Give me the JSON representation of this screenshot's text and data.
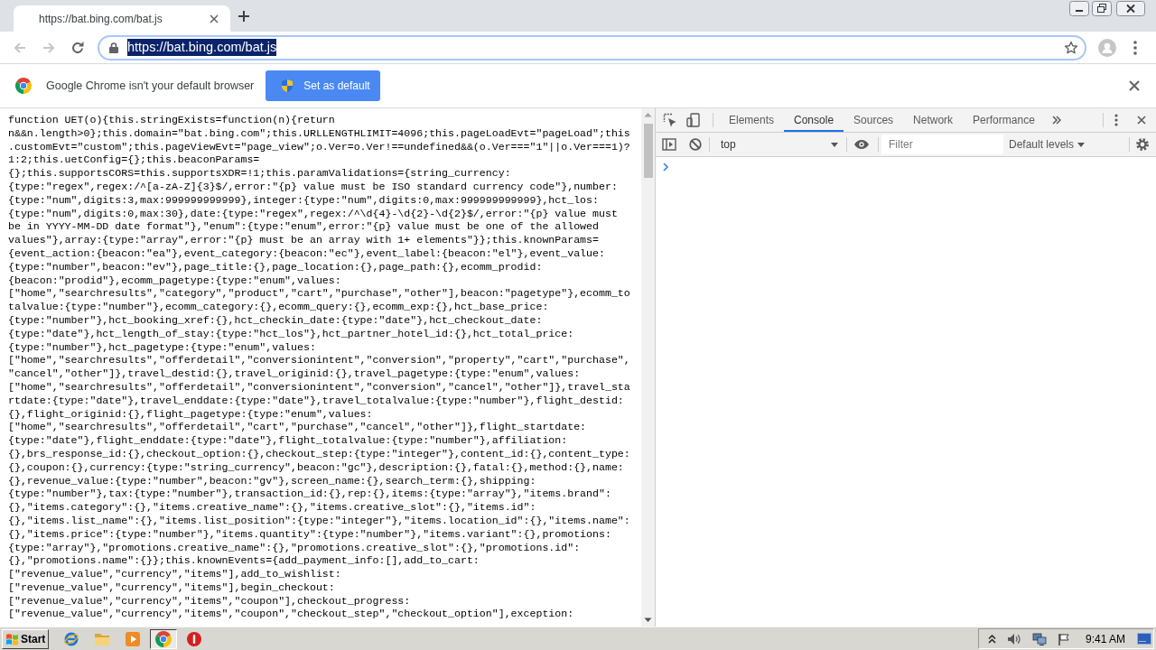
{
  "tabs": [
    {
      "title": "https://bat.bing.com/bat.js",
      "selected": true
    }
  ],
  "toolbar": {
    "nav": [
      {
        "kind": "back",
        "disabled": true
      },
      {
        "kind": "forward",
        "disabled": true
      },
      {
        "kind": "reload",
        "disabled": false
      }
    ],
    "address_bar": {
      "url": "https://bat.bing.com/bat.js",
      "selected": true
    }
  },
  "infobar": {
    "message": "Google Chrome isn't your default browser",
    "button": "Set as default"
  },
  "source": {
    "lines": [
      "function UET(o){this.stringExists=function(n){return",
      "n&&n.length>0};this.domain=\"bat.bing.com\";this.URLLENGTHLIMIT=4096;this.pageLoadEvt=\"pageLoad\";this",
      ".customEvt=\"custom\";this.pageViewEvt=\"page_view\";o.Ver=o.Ver!==undefined&&(o.Ver===\"1\"||o.Ver===1)?",
      "1:2;this.uetConfig={};this.beaconParams=",
      "{};this.supportsCORS=this.supportsXDR=!1;this.paramValidations={string_currency:",
      "{type:\"regex\",regex:/^[a-zA-Z]{3}$/,error:\"{p} value must be ISO standard currency code\"},number:",
      "{type:\"num\",digits:3,max:999999999999},integer:{type:\"num\",digits:0,max:999999999999},hct_los:",
      "{type:\"num\",digits:0,max:30},date:{type:\"regex\",regex:/^\\d{4}-\\d{2}-\\d{2}$/,error:\"{p} value must",
      "be in YYYY-MM-DD date format\"},\"enum\":{type:\"enum\",error:\"{p} value must be one of the allowed",
      "values\"},array:{type:\"array\",error:\"{p} must be an array with 1+ elements\"}};this.knownParams=",
      "{event_action:{beacon:\"ea\"},event_category:{beacon:\"ec\"},event_label:{beacon:\"el\"},event_value:",
      "{type:\"number\",beacon:\"ev\"},page_title:{},page_location:{},page_path:{},ecomm_prodid:",
      "{beacon:\"prodid\"},ecomm_pagetype:{type:\"enum\",values:",
      "[\"home\",\"searchresults\",\"category\",\"product\",\"cart\",\"purchase\",\"other\"],beacon:\"pagetype\"},ecomm_to",
      "talvalue:{type:\"number\"},ecomm_category:{},ecomm_query:{},ecomm_exp:{},hct_base_price:",
      "{type:\"number\"},hct_booking_xref:{},hct_checkin_date:{type:\"date\"},hct_checkout_date:",
      "{type:\"date\"},hct_length_of_stay:{type:\"hct_los\"},hct_partner_hotel_id:{},hct_total_price:",
      "{type:\"number\"},hct_pagetype:{type:\"enum\",values:",
      "[\"home\",\"searchresults\",\"offerdetail\",\"conversionintent\",\"conversion\",\"property\",\"cart\",\"purchase\",",
      "\"cancel\",\"other\"]},travel_destid:{},travel_originid:{},travel_pagetype:{type:\"enum\",values:",
      "[\"home\",\"searchresults\",\"offerdetail\",\"conversionintent\",\"conversion\",\"cancel\",\"other\"]},travel_sta",
      "rtdate:{type:\"date\"},travel_enddate:{type:\"date\"},travel_totalvalue:{type:\"number\"},flight_destid:",
      "{},flight_originid:{},flight_pagetype:{type:\"enum\",values:",
      "[\"home\",\"searchresults\",\"offerdetail\",\"cart\",\"purchase\",\"cancel\",\"other\"]},flight_startdate:",
      "{type:\"date\"},flight_enddate:{type:\"date\"},flight_totalvalue:{type:\"number\"},affiliation:",
      "{},brs_response_id:{},checkout_option:{},checkout_step:{type:\"integer\"},content_id:{},content_type:",
      "{},coupon:{},currency:{type:\"string_currency\",beacon:\"gc\"},description:{},fatal:{},method:{},name:",
      "{},revenue_value:{type:\"number\",beacon:\"gv\"},screen_name:{},search_term:{},shipping:",
      "{type:\"number\"},tax:{type:\"number\"},transaction_id:{},rep:{},items:{type:\"array\"},\"items.brand\":",
      "{},\"items.category\":{},\"items.creative_name\":{},\"items.creative_slot\":{},\"items.id\":",
      "{},\"items.list_name\":{},\"items.list_position\":{type:\"integer\"},\"items.location_id\":{},\"items.name\":",
      "{},\"items.price\":{type:\"number\"},\"items.quantity\":{type:\"number\"},\"items.variant\":{},promotions:",
      "{type:\"array\"},\"promotions.creative_name\":{},\"promotions.creative_slot\":{},\"promotions.id\":",
      "{},\"promotions.name\":{}};this.knownEvents={add_payment_info:[],add_to_cart:",
      "[\"revenue_value\",\"currency\",\"items\"],add_to_wishlist:",
      "[\"revenue_value\",\"currency\",\"items\"],begin_checkout:",
      "[\"revenue_value\",\"currency\",\"items\",\"coupon\"],checkout_progress:",
      "[\"revenue_value\",\"currency\",\"items\",\"coupon\",\"checkout_step\",\"checkout_option\"],exception:"
    ]
  },
  "devtools": {
    "tabs": [
      {
        "label": "Elements",
        "selected": false
      },
      {
        "label": "Console",
        "selected": true
      },
      {
        "label": "Sources",
        "selected": false
      },
      {
        "label": "Network",
        "selected": false
      },
      {
        "label": "Performance",
        "selected": false
      }
    ],
    "context": "top",
    "filter": {
      "placeholder": "Filter"
    },
    "levels": "Default levels"
  },
  "taskbar": {
    "start": "Start",
    "apps": [
      {
        "kind": "explorer",
        "selected": false
      },
      {
        "kind": "folder",
        "selected": false
      },
      {
        "kind": "player",
        "selected": false
      },
      {
        "kind": "chrome",
        "selected": true
      },
      {
        "kind": "stop",
        "selected": false
      }
    ],
    "clock": "9:41 AM"
  }
}
